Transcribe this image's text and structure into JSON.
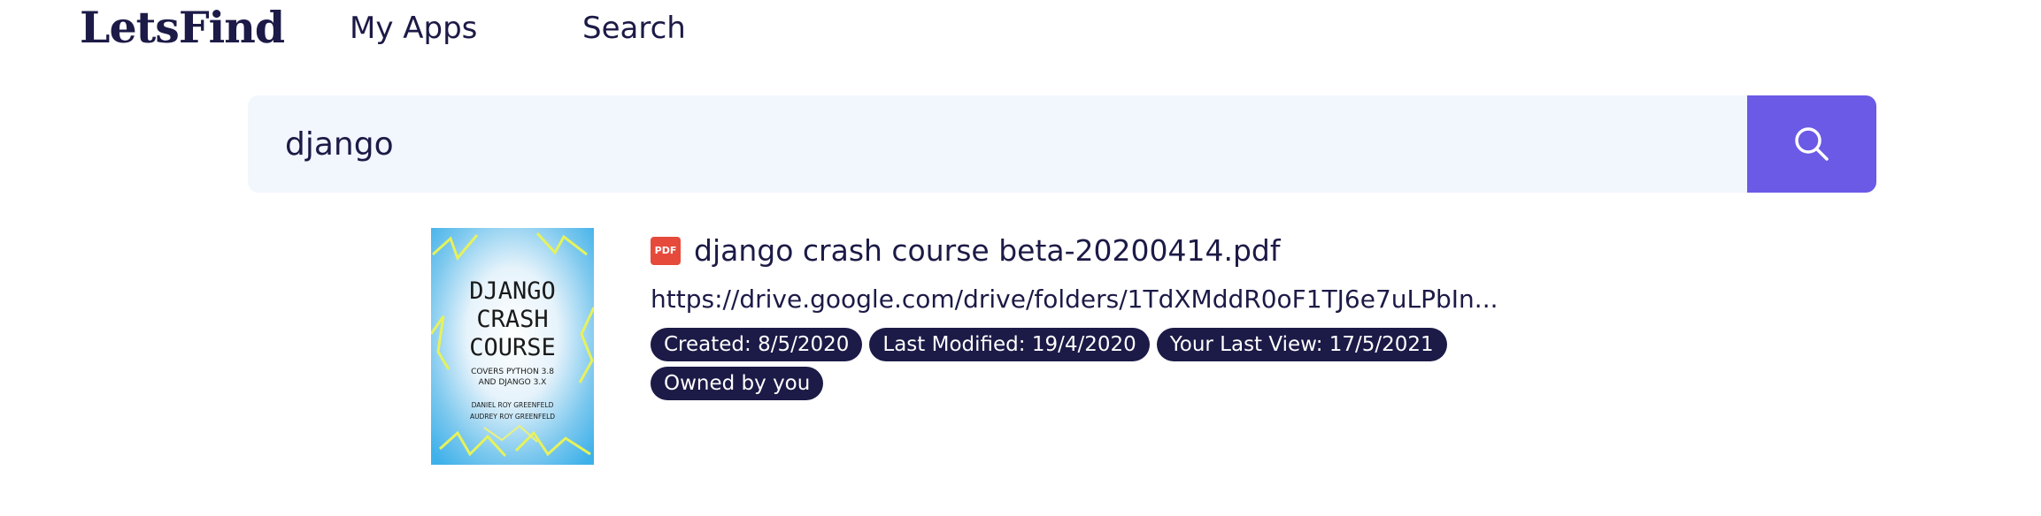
{
  "nav": {
    "logo": "LetsFind",
    "links": [
      "My Apps",
      "Search"
    ]
  },
  "search": {
    "value": "django",
    "button_icon": "search-icon"
  },
  "results": [
    {
      "file_type_icon": "pdf-icon",
      "file_type_label": "PDF",
      "title": "django crash course beta-20200414.pdf",
      "url": "https://drive.google.com/drive/folders/1TdXMddR0oF1TJ6e7uLPbIn...",
      "badges": [
        "Created: 8/5/2020",
        "Last Modified: 19/4/2020",
        "Your Last View: 17/5/2021",
        "Owned by you"
      ],
      "cover": {
        "lines": [
          "DJANGO",
          "CRASH",
          "COURSE"
        ],
        "subtitle": [
          "COVERS PYTHON 3.8",
          "AND DJANGO 3.X"
        ],
        "authors": [
          "DANIEL ROY GREENFELD",
          "AUDREY ROY GREENFELD"
        ]
      }
    }
  ],
  "colors": {
    "text": "#1c1a46",
    "search_bg": "#f2f6fd",
    "accent": "#6a5ae6",
    "badge_bg": "#1c1a46",
    "pdf_red": "#e64a3b"
  }
}
